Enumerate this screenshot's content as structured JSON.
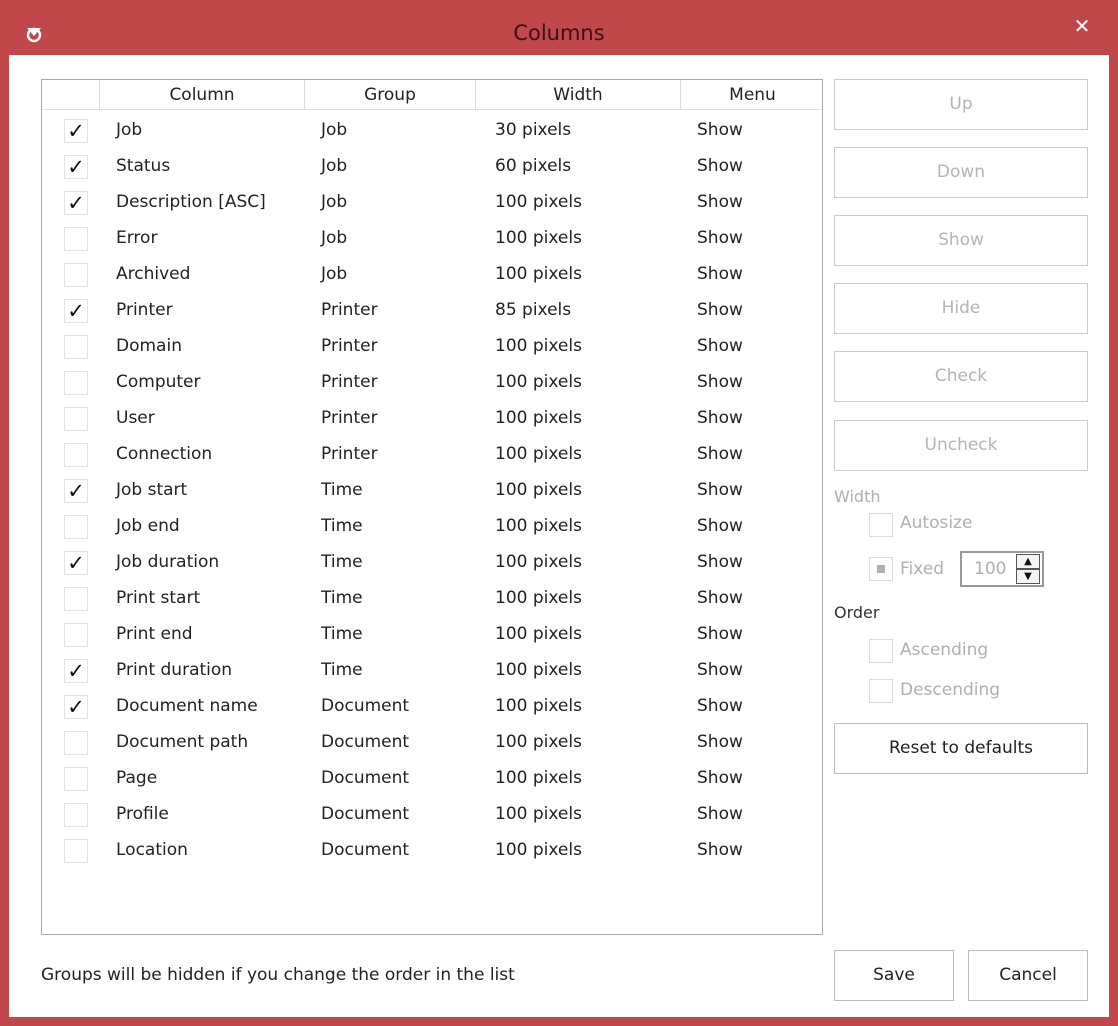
{
  "window": {
    "title": "Columns",
    "close_glyph": "✕",
    "app_icon": "app-logo-icon"
  },
  "table": {
    "headers": {
      "column": "Column",
      "group": "Group",
      "width": "Width",
      "menu": "Menu"
    },
    "rows": [
      {
        "checked": true,
        "column": "Job",
        "group": "Job",
        "width": "30 pixels",
        "menu": "Show"
      },
      {
        "checked": true,
        "column": "Status",
        "group": "Job",
        "width": "60 pixels",
        "menu": "Show"
      },
      {
        "checked": true,
        "column": "Description [ASC]",
        "group": "Job",
        "width": "100 pixels",
        "menu": "Show"
      },
      {
        "checked": false,
        "column": "Error",
        "group": "Job",
        "width": "100 pixels",
        "menu": "Show"
      },
      {
        "checked": false,
        "column": "Archived",
        "group": "Job",
        "width": "100 pixels",
        "menu": "Show"
      },
      {
        "checked": true,
        "column": "Printer",
        "group": "Printer",
        "width": "85 pixels",
        "menu": "Show"
      },
      {
        "checked": false,
        "column": "Domain",
        "group": "Printer",
        "width": "100 pixels",
        "menu": "Show"
      },
      {
        "checked": false,
        "column": "Computer",
        "group": "Printer",
        "width": "100 pixels",
        "menu": "Show"
      },
      {
        "checked": false,
        "column": "User",
        "group": "Printer",
        "width": "100 pixels",
        "menu": "Show"
      },
      {
        "checked": false,
        "column": "Connection",
        "group": "Printer",
        "width": "100 pixels",
        "menu": "Show"
      },
      {
        "checked": true,
        "column": "Job start",
        "group": "Time",
        "width": "100 pixels",
        "menu": "Show"
      },
      {
        "checked": false,
        "column": "Job end",
        "group": "Time",
        "width": "100 pixels",
        "menu": "Show"
      },
      {
        "checked": true,
        "column": "Job duration",
        "group": "Time",
        "width": "100 pixels",
        "menu": "Show"
      },
      {
        "checked": false,
        "column": "Print start",
        "group": "Time",
        "width": "100 pixels",
        "menu": "Show"
      },
      {
        "checked": false,
        "column": "Print end",
        "group": "Time",
        "width": "100 pixels",
        "menu": "Show"
      },
      {
        "checked": true,
        "column": "Print duration",
        "group": "Time",
        "width": "100 pixels",
        "menu": "Show"
      },
      {
        "checked": true,
        "column": "Document name",
        "group": "Document",
        "width": "100 pixels",
        "menu": "Show"
      },
      {
        "checked": false,
        "column": "Document path",
        "group": "Document",
        "width": "100 pixels",
        "menu": "Show"
      },
      {
        "checked": false,
        "column": "Page",
        "group": "Document",
        "width": "100 pixels",
        "menu": "Show"
      },
      {
        "checked": false,
        "column": "Profile",
        "group": "Document",
        "width": "100 pixels",
        "menu": "Show"
      },
      {
        "checked": false,
        "column": "Location",
        "group": "Document",
        "width": "100 pixels",
        "menu": "Show"
      }
    ]
  },
  "side": {
    "up": "Up",
    "down": "Down",
    "show": "Show",
    "hide": "Hide",
    "check": "Check",
    "uncheck": "Uncheck",
    "width_label": "Width",
    "autosize": "Autosize",
    "fixed": "Fixed",
    "fixed_value": "100",
    "order_label": "Order",
    "ascending": "Ascending",
    "descending": "Descending",
    "reset": "Reset to defaults"
  },
  "footer": {
    "note": "Groups will be hidden if you change the order in the list",
    "save": "Save",
    "cancel": "Cancel"
  },
  "colors": {
    "title_bar": "#c0474a",
    "disabled_text": "#b4b4b4"
  }
}
